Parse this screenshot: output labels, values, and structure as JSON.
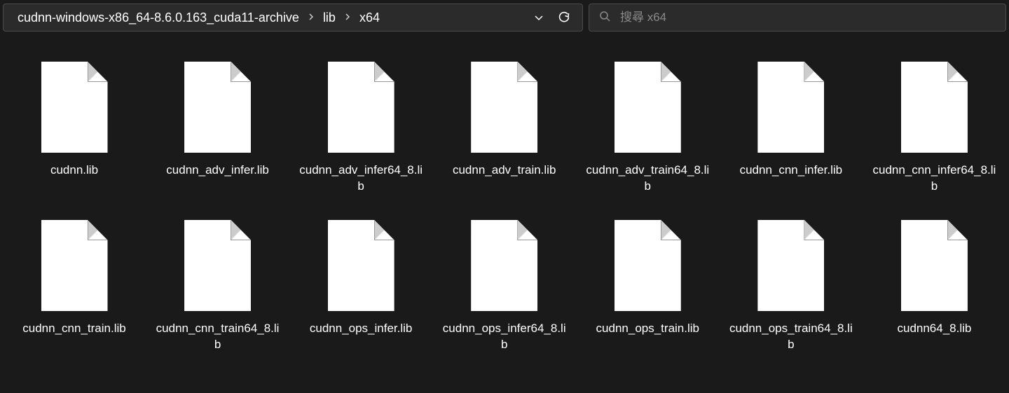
{
  "breadcrumb": {
    "segments": [
      "cudnn-windows-x86_64-8.6.0.163_cuda11-archive",
      "lib",
      "x64"
    ]
  },
  "search": {
    "placeholder": "搜尋 x64"
  },
  "files": [
    {
      "name": "cudnn.lib"
    },
    {
      "name": "cudnn_adv_infer.lib"
    },
    {
      "name": "cudnn_adv_infer64_8.lib"
    },
    {
      "name": "cudnn_adv_train.lib"
    },
    {
      "name": "cudnn_adv_train64_8.lib"
    },
    {
      "name": "cudnn_cnn_infer.lib"
    },
    {
      "name": "cudnn_cnn_infer64_8.lib"
    },
    {
      "name": "cudnn_cnn_train.lib"
    },
    {
      "name": "cudnn_cnn_train64_8.lib"
    },
    {
      "name": "cudnn_ops_infer.lib"
    },
    {
      "name": "cudnn_ops_infer64_8.lib"
    },
    {
      "name": "cudnn_ops_train.lib"
    },
    {
      "name": "cudnn_ops_train64_8.lib"
    },
    {
      "name": "cudnn64_8.lib"
    }
  ]
}
